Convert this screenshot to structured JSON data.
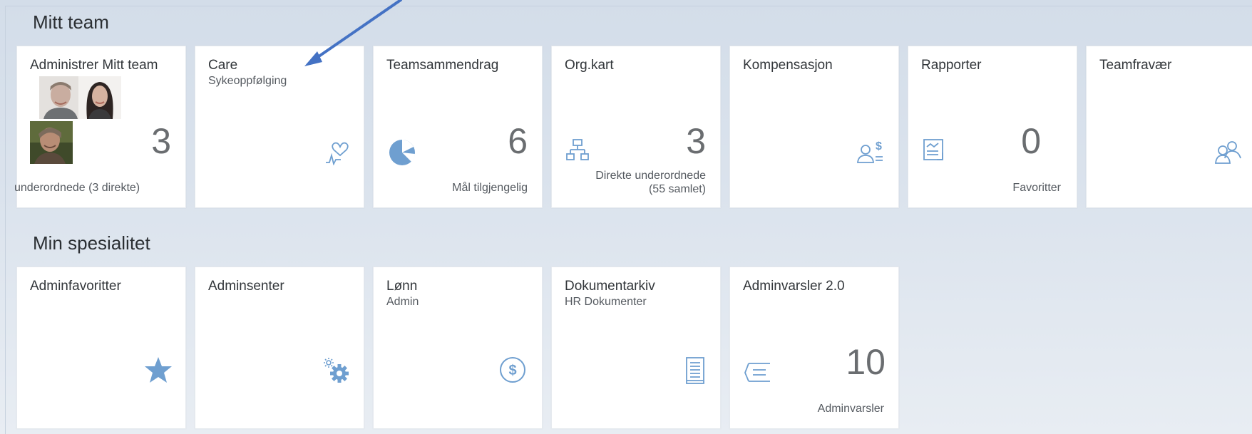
{
  "sections": {
    "team": {
      "title": "Mitt team"
    },
    "specialty": {
      "title": "Min spesialitet"
    }
  },
  "team_tiles": {
    "admin_team": {
      "title": "Administrer Mitt team",
      "number": "3",
      "footer": "underordnede (3 direkte)"
    },
    "care": {
      "title": "Care",
      "subtitle": "Sykeoppfølging",
      "icon": "heart-pulse-icon"
    },
    "summary": {
      "title": "Teamsammendrag",
      "number": "6",
      "footer": "Mål tilgjengelig",
      "icon": "pie-chart-icon"
    },
    "orgchart": {
      "title": "Org.kart",
      "number": "3",
      "footer": "Direkte underordnede\n(55 samlet)",
      "icon": "org-chart-icon"
    },
    "compensation": {
      "title": "Kompensasjon",
      "icon": "person-dollar-icon"
    },
    "reports": {
      "title": "Rapporter",
      "number": "0",
      "footer": "Favoritter",
      "icon": "report-icon"
    },
    "absence": {
      "title": "Teamfravær",
      "icon": "people-icon"
    }
  },
  "specialty_tiles": {
    "admin_favorites": {
      "title": "Adminfavoritter",
      "icon": "star-icon"
    },
    "admin_center": {
      "title": "Adminsenter",
      "icon": "gears-icon"
    },
    "payroll": {
      "title": "Lønn",
      "subtitle": "Admin",
      "icon": "dollar-circle-icon"
    },
    "documents": {
      "title": "Dokumentarkiv",
      "subtitle": "HR Dokumenter",
      "icon": "document-icon"
    },
    "admin_alerts": {
      "title": "Adminvarsler 2.0",
      "number": "10",
      "footer": "Adminvarsler",
      "icon": "list-icon"
    }
  },
  "colors": {
    "icon": "#6f9fd0",
    "arrow": "#4472c4"
  }
}
